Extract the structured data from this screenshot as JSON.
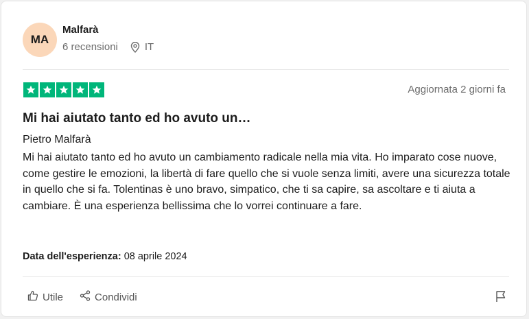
{
  "reviewer": {
    "initials": "MA",
    "name": "Malfarà",
    "review_count": "6 recensioni",
    "country": "IT",
    "avatar_color": "#fbd7b9"
  },
  "review": {
    "rating": 5,
    "rating_max": 5,
    "star_color": "#00b67a",
    "updated": "Aggiornata 2 giorni fa",
    "title": "Mi hai aiutato tanto ed ho avuto un…",
    "author": "Pietro Malfarà",
    "body": "Mi hai aiutato tanto ed ho avuto un cambiamento radicale nella mia vita. Ho imparato cose nuove, come gestire le emozioni, la libertà di fare quello che si vuole senza limiti, avere una sicurezza totale in quello che si fa. Tolentinas è uno bravo, simpatico, che ti sa capire, sa ascoltare e ti aiuta a cambiare. È una esperienza bellissima che lo vorrei continuare a fare.",
    "experience_label": "Data dell'esperienza:",
    "experience_date": "08 aprile 2024"
  },
  "actions": {
    "useful_label": "Utile",
    "share_label": "Condividi"
  },
  "icons": {
    "location": "location-pin-icon",
    "star": "star-icon",
    "useful": "thumbs-up-icon",
    "share": "share-icon",
    "flag": "flag-icon"
  }
}
